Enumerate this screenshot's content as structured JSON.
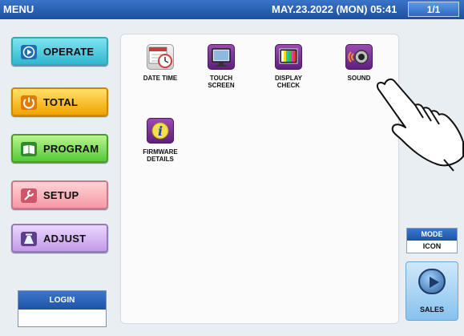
{
  "titlebar": {
    "title": "MENU",
    "datetime": "MAY.23.2022 (MON) 05:41",
    "page": "1/1",
    "colors": {
      "bar": "#2c61b2"
    }
  },
  "nav": {
    "operate": "OPERATE",
    "total": "TOTAL",
    "program": "PROGRAM",
    "setup": "SETUP",
    "adjust": "ADJUST"
  },
  "login": {
    "label": "LOGIN",
    "value": ""
  },
  "menu_items": [
    {
      "icon": "clock-calendar-icon",
      "label_line1": "DATE TIME",
      "label_line2": ""
    },
    {
      "icon": "touch-screen-monitor-icon",
      "label_line1": "TOUCH",
      "label_line2": "SCREEN"
    },
    {
      "icon": "display-check-bars-icon",
      "label_line1": "DISPLAY",
      "label_line2": "CHECK"
    },
    {
      "icon": "speaker-sound-icon",
      "label_line1": "SOUND",
      "label_line2": ""
    },
    {
      "icon": "info-icon",
      "label_line1": "FIRMWARE",
      "label_line2": "DETAILS"
    }
  ],
  "mode": {
    "label": "MODE",
    "value": "ICON"
  },
  "sales": {
    "label": "SALES",
    "icon": "play-circle-icon"
  }
}
